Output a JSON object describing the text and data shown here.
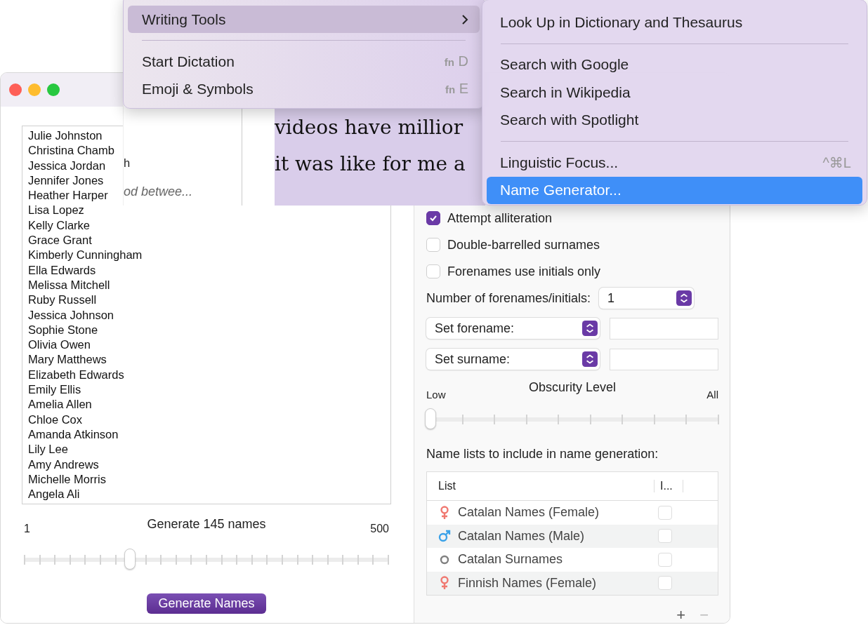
{
  "context_menu": {
    "items": [
      {
        "kind": "submenu",
        "label": "Writing Tools",
        "selected": true
      },
      {
        "kind": "separator"
      },
      {
        "kind": "item",
        "label": "Start Dictation",
        "shortcut_prefix": "fn",
        "shortcut": "D",
        "selected": false
      },
      {
        "kind": "item",
        "label": "Emoji & Symbols",
        "shortcut_prefix": "fn",
        "shortcut": "E",
        "selected": false
      }
    ]
  },
  "submenu": {
    "items": [
      {
        "kind": "item",
        "label": "Look Up in Dictionary and Thesaurus",
        "selected": false
      },
      {
        "kind": "separator"
      },
      {
        "kind": "item",
        "label": "Search with Google",
        "selected": false
      },
      {
        "kind": "item",
        "label": "Search in Wikipedia",
        "selected": false
      },
      {
        "kind": "item",
        "label": "Search with Spotlight",
        "selected": false
      },
      {
        "kind": "separator"
      },
      {
        "kind": "item",
        "label": "Linguistic Focus...",
        "shortcut": "^⌘L",
        "selected": false
      },
      {
        "kind": "item",
        "label": "Name Generator...",
        "selected": true
      }
    ]
  },
  "document": {
    "fragment": "h",
    "snippet": "od betwee...",
    "lines": [
      "videos have millior",
      "it was like for me a"
    ]
  },
  "window": {
    "names": [
      "Julie Johnston",
      "Christina Chamb",
      "Jessica Jordan",
      "Jennifer Jones",
      "Heather Harper",
      "Lisa Lopez",
      "Kelly Clarke",
      "Grace Grant",
      "Kimberly Cunningham",
      "Ella Edwards",
      "Melissa Mitchell",
      "Ruby Russell",
      "Jessica Johnson",
      "Sophie Stone",
      "Olivia Owen",
      "Mary Matthews",
      "Elizabeth Edwards",
      "Emily Ellis",
      "Amelia Allen",
      "Chloe Cox",
      "Amanda Atkinson",
      "Lily Lee",
      "Amy Andrews",
      "Michelle Morris",
      "Angela Ali"
    ],
    "count_slider": {
      "label": "Generate 145 names",
      "min_label": "1",
      "max_label": "500",
      "level": 0.29
    },
    "generate_button": "Generate Names",
    "options": [
      {
        "label": "Attempt alliteration",
        "checked": true
      },
      {
        "label": "Double-barrelled surnames",
        "checked": false
      },
      {
        "label": "Forenames use initials only",
        "checked": false
      }
    ],
    "forenames_count": {
      "label": "Number of forenames/initials:",
      "value": "1"
    },
    "set_fields": [
      {
        "label": "Set forename:"
      },
      {
        "label": "Set surname:"
      }
    ],
    "obscurity": {
      "title": "Obscurity Level",
      "min_label": "Low",
      "max_label": "All",
      "level": 0
    },
    "lists_label": "Name lists to include in name generation:",
    "table": {
      "columns": [
        "List",
        "I..."
      ],
      "rows": [
        {
          "kind": "female",
          "name": "Catalan Names (Female)",
          "checked": false
        },
        {
          "kind": "male",
          "name": "Catalan Names (Male)",
          "checked": false
        },
        {
          "kind": "neutral",
          "name": "Catalan Surnames",
          "checked": false
        },
        {
          "kind": "female",
          "name": "Finnish Names (Female)",
          "checked": false
        }
      ]
    },
    "add_button": "+",
    "remove_button": "−"
  }
}
